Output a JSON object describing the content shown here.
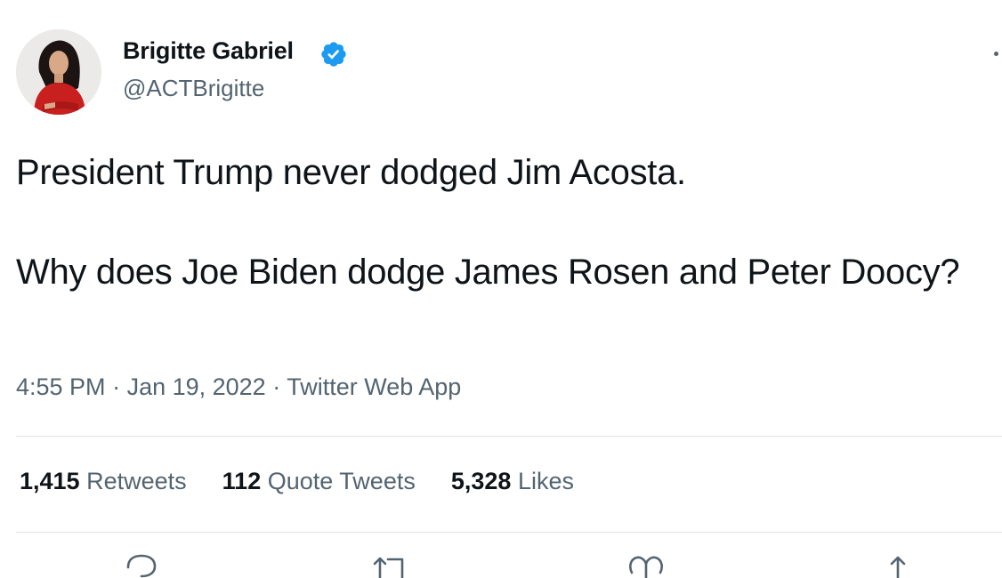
{
  "author": {
    "name": "Brigitte Gabriel",
    "handle": "@ACTBrigitte",
    "verified": true
  },
  "tweet": {
    "line1": "President Trump never dodged Jim Acosta.",
    "line2": "Why does Joe Biden dodge James Rosen and Peter Doocy?"
  },
  "meta": {
    "time": "4:55 PM",
    "separator1": " · ",
    "date": "Jan 19, 2022",
    "separator2": " · ",
    "source": "Twitter Web App"
  },
  "stats": [
    {
      "value": "1,415",
      "label": "Retweets"
    },
    {
      "value": "112",
      "label": "Quote Tweets"
    },
    {
      "value": "5,328",
      "label": "Likes"
    }
  ],
  "icons": {
    "verified": "verified-badge-icon",
    "more": "more-options-icon",
    "reply": "reply-icon",
    "retweet": "retweet-icon",
    "like": "heart-icon",
    "share": "share-icon"
  },
  "colors": {
    "text": "#0f1419",
    "secondary": "#536471",
    "verified": "#1d9bf0",
    "divider": "#dfe3e6"
  }
}
